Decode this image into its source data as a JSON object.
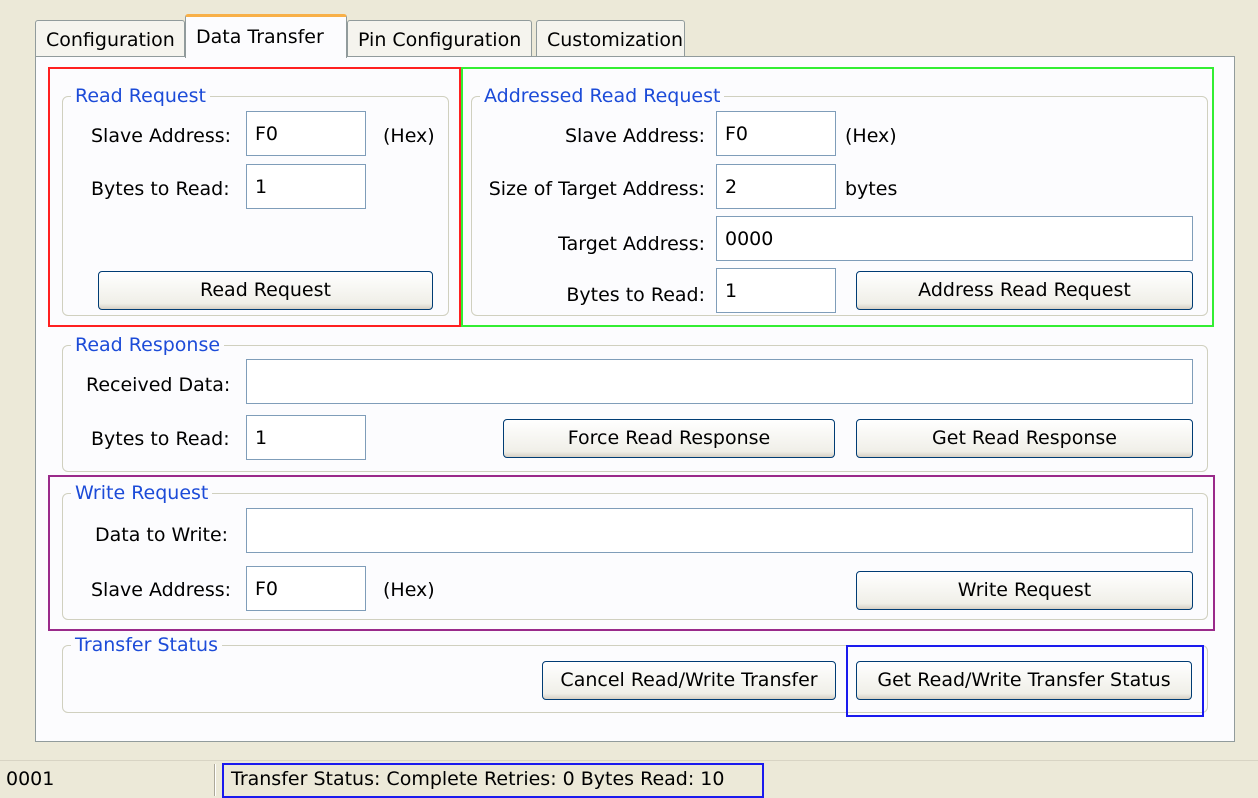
{
  "tabs": [
    "Configuration",
    "Data Transfer",
    "Pin Configuration",
    "Customization"
  ],
  "read_request": {
    "legend": "Read Request",
    "slave_address_label": "Slave Address:",
    "slave_address_value": "F0",
    "hex_label": "(Hex)",
    "bytes_to_read_label": "Bytes to Read:",
    "bytes_to_read_value": "1",
    "button": "Read Request"
  },
  "addressed_read_request": {
    "legend": "Addressed Read Request",
    "slave_address_label": "Slave Address:",
    "slave_address_value": "F0",
    "hex_label": "(Hex)",
    "target_size_label": "Size of Target Address:",
    "target_size_value": "2",
    "bytes_unit": "bytes",
    "target_address_label": "Target Address:",
    "target_address_value": "0000",
    "bytes_to_read_label": "Bytes to Read:",
    "bytes_to_read_value": "1",
    "button": "Address Read Request"
  },
  "read_response": {
    "legend": "Read Response",
    "received_data_label": "Received Data:",
    "received_data_value": "",
    "bytes_to_read_label": "Bytes to Read:",
    "bytes_to_read_value": "1",
    "force_button": "Force Read Response",
    "get_button": "Get Read Response"
  },
  "write_request": {
    "legend": "Write Request",
    "data_label": "Data to Write:",
    "data_value": "",
    "slave_address_label": "Slave Address:",
    "slave_address_value": "F0",
    "hex_label": "(Hex)",
    "button": "Write Request"
  },
  "transfer_status": {
    "legend": "Transfer Status",
    "cancel_button": "Cancel Read/Write Transfer",
    "get_button": "Get Read/Write Transfer Status"
  },
  "status_bar": {
    "left": "0001",
    "message": "Transfer Status: Complete  Retries: 0  Bytes Read: 10"
  },
  "highlight_colors": {
    "red": "#ff2020",
    "green": "#33ee33",
    "purple": "#9a2a8a",
    "blue": "#1a1aee"
  }
}
